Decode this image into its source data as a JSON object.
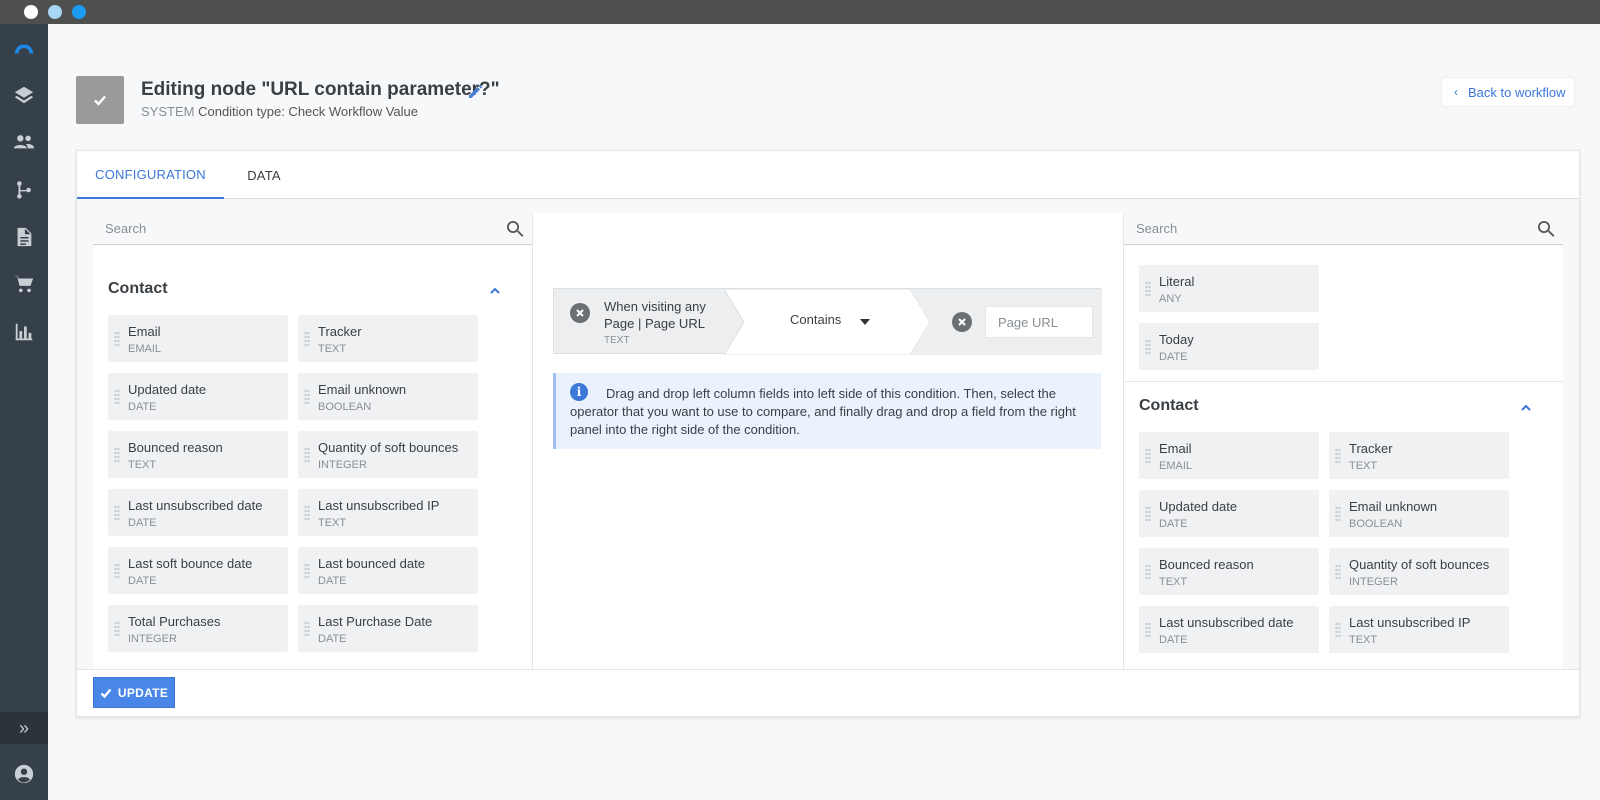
{
  "window": {
    "controls": [
      "close",
      "minimize",
      "maximize"
    ]
  },
  "nav": {
    "icons": [
      "logo-icon",
      "layers-icon",
      "users-icon",
      "workflow-icon",
      "document-icon",
      "cart-icon",
      "chart-icon"
    ],
    "expand_icon": "double-chevron-right-icon",
    "account_icon": "account-icon"
  },
  "header": {
    "title": "Editing node \"URL contain parameter?\"",
    "system_label": "SYSTEM",
    "condition_type": "Condition type: Check Workflow Value",
    "back_label": "Back to workflow"
  },
  "tabs": [
    {
      "label": "CONFIGURATION",
      "active": true
    },
    {
      "label": "DATA",
      "active": false
    }
  ],
  "left_panel": {
    "search_placeholder": "Search",
    "section": "Contact",
    "fields": [
      {
        "name": "Email",
        "type": "EMAIL"
      },
      {
        "name": "Tracker",
        "type": "TEXT"
      },
      {
        "name": "Updated date",
        "type": "DATE"
      },
      {
        "name": "Email unknown",
        "type": "BOOLEAN"
      },
      {
        "name": "Bounced reason",
        "type": "TEXT"
      },
      {
        "name": "Quantity of soft bounces",
        "type": "INTEGER"
      },
      {
        "name": "Last unsubscribed date",
        "type": "DATE"
      },
      {
        "name": "Last unsubscribed IP",
        "type": "TEXT"
      },
      {
        "name": "Last soft bounce date",
        "type": "DATE"
      },
      {
        "name": "Last bounced date",
        "type": "DATE"
      },
      {
        "name": "Total Purchases",
        "type": "INTEGER"
      },
      {
        "name": "Last Purchase Date",
        "type": "DATE"
      }
    ]
  },
  "condition": {
    "left_text": "When visiting any Page | Page URL",
    "left_type": "TEXT",
    "operator": "Contains",
    "right_placeholder": "Page URL"
  },
  "info": {
    "text": "Drag and drop left column fields into left side of this condition. Then, select the operator that you want to use to compare, and finally drag and drop a field from the right panel into the right side of the condition."
  },
  "right_panel": {
    "search_placeholder": "Search",
    "top_fields": [
      {
        "name": "Literal",
        "type": "ANY"
      },
      {
        "name": "Today",
        "type": "DATE"
      }
    ],
    "section": "Contact",
    "fields": [
      {
        "name": "Email",
        "type": "EMAIL"
      },
      {
        "name": "Tracker",
        "type": "TEXT"
      },
      {
        "name": "Updated date",
        "type": "DATE"
      },
      {
        "name": "Email unknown",
        "type": "BOOLEAN"
      },
      {
        "name": "Bounced reason",
        "type": "TEXT"
      },
      {
        "name": "Quantity of soft bounces",
        "type": "INTEGER"
      },
      {
        "name": "Last unsubscribed date",
        "type": "DATE"
      },
      {
        "name": "Last unsubscribed IP",
        "type": "TEXT"
      }
    ]
  },
  "footer": {
    "update_label": "UPDATE"
  },
  "colors": {
    "accent": "#3b78d8",
    "nav_bg": "#36404a",
    "titlebar": "#4f4f4f"
  }
}
